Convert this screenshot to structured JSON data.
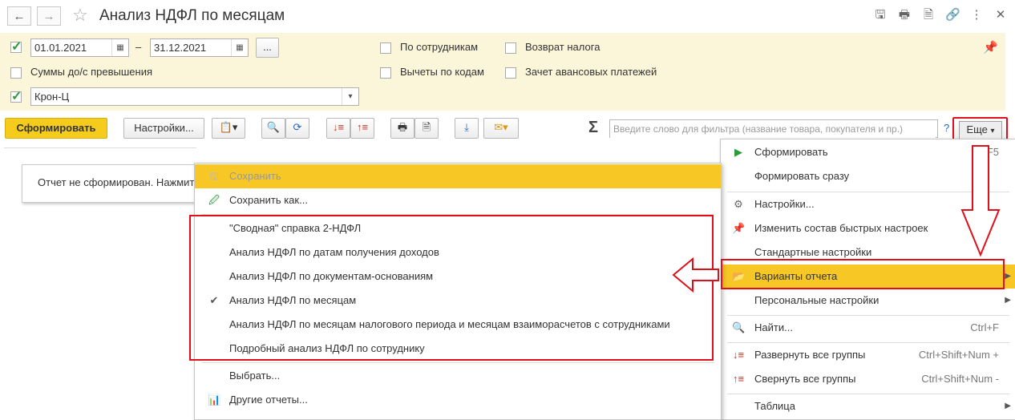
{
  "window": {
    "title": "Анализ НДФЛ по месяцам",
    "back_icon": "←",
    "forward_icon": "→",
    "star_icon": "☆",
    "tools": [
      "save-icon",
      "print-icon",
      "preview-icon",
      "link-icon",
      "more-vertical-icon",
      "close-icon"
    ],
    "tool_glyphs": [
      "🖫",
      "🖶",
      "🗎",
      "🔗",
      "⋮",
      "✕"
    ]
  },
  "filters": {
    "date_from": "01.01.2021",
    "date_to": "31.12.2021",
    "dash": "–",
    "period_button": "...",
    "by_employees": "По сотрудникам",
    "tax_refund": "Возврат налога",
    "amounts_over": "Суммы до/с превышения",
    "deductions_by_codes": "Вычеты по кодам",
    "advance_offset": "Зачет авансовых платежей",
    "organization": "Крон-Ц"
  },
  "toolbar": {
    "generate": "Сформировать",
    "settings": "Настройки...",
    "sigma": "Σ",
    "search_placeholder": "Введите слово для фильтра (название товара, покупателя и пр.)",
    "help": "?",
    "more": "Еще",
    "more_arrow": "▾"
  },
  "report": {
    "message": "Отчет не сформирован. Нажмите"
  },
  "more_menu": {
    "items": [
      {
        "label": "Сформировать",
        "shortcut": "F5"
      },
      {
        "label": "Формировать сразу",
        "shortcut": ""
      },
      {
        "label": "Настройки...",
        "shortcut": ""
      },
      {
        "label": "Изменить состав быстрых настроек",
        "shortcut": ""
      },
      {
        "label": "Стандартные настройки",
        "shortcut": ""
      },
      {
        "label": "Варианты отчета",
        "shortcut": ""
      },
      {
        "label": "Персональные настройки",
        "shortcut": ""
      },
      {
        "label": "Найти...",
        "shortcut": "Ctrl+F"
      },
      {
        "label": "Развернуть все группы",
        "shortcut": "Ctrl+Shift+Num +"
      },
      {
        "label": "Свернуть все группы",
        "shortcut": "Ctrl+Shift+Num -"
      },
      {
        "label": "Таблица",
        "shortcut": ""
      }
    ]
  },
  "variants_menu": {
    "save": "Сохранить",
    "save_as": "Сохранить как...",
    "variants": [
      "\"Сводная\" справка 2-НДФЛ",
      "Анализ НДФЛ по датам получения доходов",
      "Анализ НДФЛ по документам-основаниям",
      "Анализ НДФЛ по месяцам",
      "Анализ НДФЛ по месяцам налогового периода и месяцам взаиморасчетов с сотрудниками",
      "Подробный анализ НДФЛ по сотруднику"
    ],
    "checked_glyph": "✔",
    "select": "Выбрать...",
    "other_reports": "Другие отчеты..."
  },
  "colors": {
    "accent_yellow": "#f5cc1c",
    "panel_bg": "#fbf6d9",
    "annotation_red": "#e0101a",
    "check_green": "#2c9b3a"
  }
}
